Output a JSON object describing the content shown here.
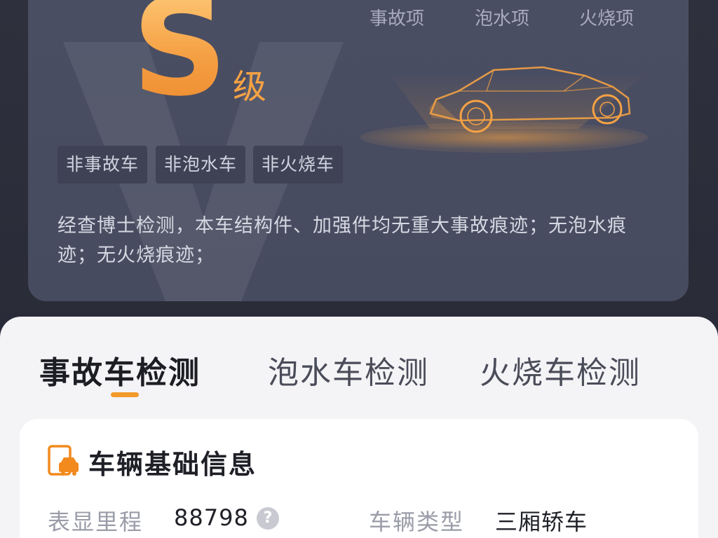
{
  "report": {
    "grade_letter": "S",
    "grade_suffix": "级",
    "columns": [
      "事故项",
      "泡水项",
      "火烧项"
    ],
    "tags": [
      "非事故车",
      "非泡水车",
      "非火烧车"
    ],
    "summary": "经查博士检测，本车结构件、加强件均无重大事故痕迹；无泡水痕迹；无火烧痕迹；",
    "accent_color": "#f5a244"
  },
  "tabs": [
    {
      "label": "事故车检测",
      "active": true
    },
    {
      "label": "泡水车检测",
      "active": false
    },
    {
      "label": "火烧车检测",
      "active": false
    }
  ],
  "basic_info": {
    "title": "车辆基础信息",
    "icon": "car-document-icon",
    "fields": [
      {
        "label": "表显里程",
        "value": "88798",
        "help_icon": "question-circle-icon"
      },
      {
        "label": "车辆类型",
        "value": "三厢轿车"
      }
    ]
  }
}
